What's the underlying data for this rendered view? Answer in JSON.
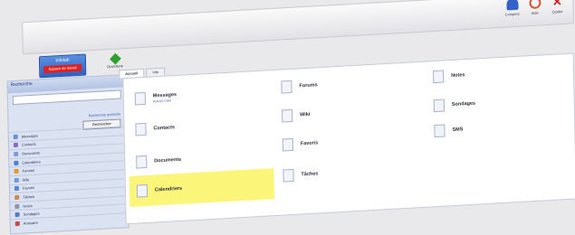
{
  "toolbar": {
    "items": [
      {
        "label": "Comptes",
        "icon": "user-icon",
        "color": "#3562c8"
      },
      {
        "label": "Aide",
        "icon": "help-icon",
        "color": "#d9502f"
      },
      {
        "label": "Quitter",
        "icon": "close-icon",
        "color": "#d42020"
      }
    ]
  },
  "app": {
    "logo_line1": "Infolab",
    "logo_line2": "Espace de travail",
    "app_button_label": "Ouverture"
  },
  "sidebar": {
    "header": "Recherche",
    "link": "Recherche avancée",
    "button": "Rechercher",
    "items": [
      {
        "label": "Messages",
        "color": "#6a8fd8"
      },
      {
        "label": "Contacts",
        "color": "#8a6cc8"
      },
      {
        "label": "Documents",
        "color": "#7a9cd6"
      },
      {
        "label": "Calendriers",
        "color": "#4f7fd0"
      },
      {
        "label": "Forums",
        "color": "#e39a2a"
      },
      {
        "label": "Wiki",
        "color": "#6aa0d8"
      },
      {
        "label": "Favoris",
        "color": "#5b86d0"
      },
      {
        "label": "Tâches",
        "color": "#c98a4a"
      },
      {
        "label": "Notes",
        "color": "#8d95a8"
      },
      {
        "label": "Sondages",
        "color": "#5a7cc6"
      },
      {
        "label": "Annuaire",
        "color": "#c84a4a"
      }
    ]
  },
  "tabs": [
    "Accueil",
    "Info"
  ],
  "tiles": [
    {
      "label": "Messages",
      "sub": "Aucun mail"
    },
    {
      "label": "Contacts",
      "sub": ""
    },
    {
      "label": "Documents",
      "sub": ""
    },
    {
      "label": "Calendriers",
      "sub": ""
    },
    {
      "label": "Forums",
      "sub": ""
    },
    {
      "label": "Wiki",
      "sub": ""
    },
    {
      "label": "Favoris",
      "sub": ""
    },
    {
      "label": "Tâches",
      "sub": ""
    },
    {
      "label": "Notes",
      "sub": ""
    },
    {
      "label": "Sondages",
      "sub": ""
    },
    {
      "label": "SMS",
      "sub": ""
    }
  ],
  "highlight_color": "#fbf57a"
}
